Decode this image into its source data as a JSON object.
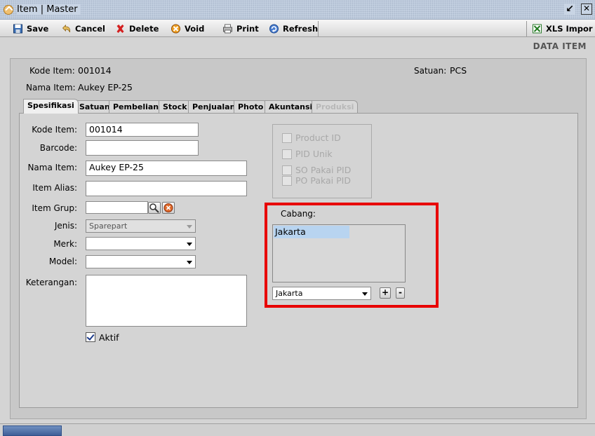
{
  "window": {
    "title": "Item | Master",
    "controls": [
      "restore-icon",
      "close-icon"
    ]
  },
  "toolbar": {
    "save": "Save",
    "cancel": "Cancel",
    "delete": "Delete",
    "void": "Void",
    "print": "Print",
    "refresh": "Refresh",
    "xls_import": "XLS Impor"
  },
  "header": {
    "section_title": "DATA ITEM",
    "kode_item_label": "Kode Item:",
    "kode_item_value": "001014",
    "nama_item_label": "Nama Item:",
    "nama_item_value": "Aukey EP-25",
    "satuan_label": "Satuan:",
    "satuan_value": "PCS"
  },
  "tabs": [
    {
      "label": "Spesifikasi",
      "active": true
    },
    {
      "label": "Satuan"
    },
    {
      "label": "Pembelian"
    },
    {
      "label": "Stock"
    },
    {
      "label": "Penjualan"
    },
    {
      "label": "Photo"
    },
    {
      "label": "Akuntansi"
    },
    {
      "label": "Produksi",
      "disabled": true
    }
  ],
  "form": {
    "kode_item": {
      "label": "Kode Item:",
      "value": "001014"
    },
    "barcode": {
      "label": "Barcode:",
      "value": ""
    },
    "nama_item": {
      "label": "Nama Item:",
      "value": "Aukey EP-25"
    },
    "item_alias": {
      "label": "Item Alias:",
      "value": ""
    },
    "item_grup": {
      "label": "Item Grup:",
      "value": ""
    },
    "jenis": {
      "label": "Jenis:",
      "value": "Sparepart"
    },
    "merk": {
      "label": "Merk:",
      "value": ""
    },
    "model": {
      "label": "Model:",
      "value": ""
    },
    "keterangan": {
      "label": "Keterangan:",
      "value": ""
    },
    "aktif": {
      "label": "Aktif",
      "checked": true
    }
  },
  "pid": {
    "product_id": "Product ID",
    "pid_unik": "PID Unik",
    "so_pakai_pid": "SO Pakai PID",
    "po_pakai_pid": "PO Pakai PID"
  },
  "cabang": {
    "label": "Cabang:",
    "list_items": [
      "Jakarta"
    ],
    "selected": "Jakarta",
    "add_label": "+",
    "remove_label": "-",
    "highlight_color": "#e80000"
  }
}
